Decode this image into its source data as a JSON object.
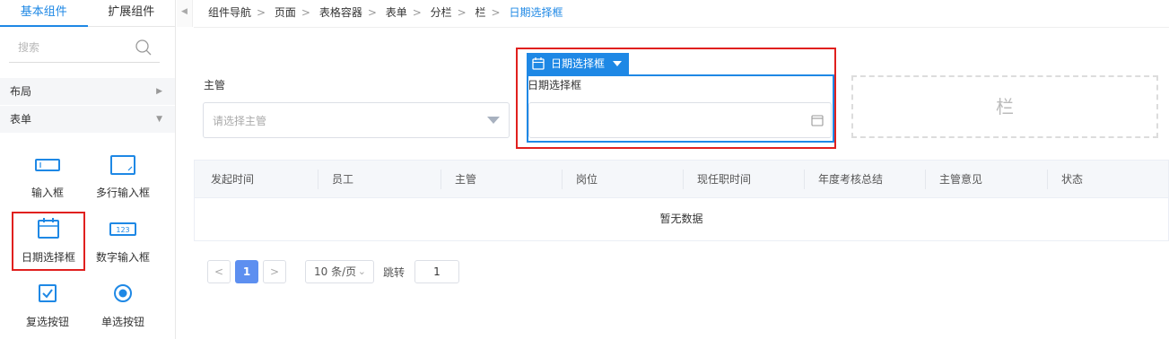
{
  "sidebar": {
    "tabs": [
      {
        "label": "基本组件",
        "active": true
      },
      {
        "label": "扩展组件",
        "active": false
      }
    ],
    "search_placeholder": "搜索",
    "groups": [
      {
        "label": "布局",
        "state": "collapsed"
      },
      {
        "label": "表单",
        "state": "expanded"
      }
    ],
    "components": [
      {
        "label": "输入框",
        "icon": "input-icon"
      },
      {
        "label": "多行输入框",
        "icon": "textarea-icon"
      },
      {
        "label": "日期选择框",
        "icon": "calendar-icon",
        "selected": true
      },
      {
        "label": "数字输入框",
        "icon": "number-input-icon"
      },
      {
        "label": "复选按钮",
        "icon": "checkbox-icon"
      },
      {
        "label": "单选按钮",
        "icon": "radio-icon"
      }
    ]
  },
  "breadcrumb": {
    "items": [
      "组件导航",
      "页面",
      "表格容器",
      "表单",
      "分栏",
      "栏"
    ],
    "current": "日期选择框"
  },
  "form": {
    "supervisor_label": "主管",
    "supervisor_placeholder": "请选择主管",
    "date_chip_label": "日期选择框",
    "date_field_label": "日期选择框",
    "column_placeholder": "栏"
  },
  "table": {
    "columns": [
      "发起时间",
      "员工",
      "主管",
      "岗位",
      "现任职时间",
      "年度考核总结",
      "主管意见",
      "状态"
    ],
    "rows": [],
    "empty_text": "暂无数据"
  },
  "pagination": {
    "prev": "<",
    "next": ">",
    "current_page": "1",
    "page_size": "10 条/页",
    "jump_label": "跳转",
    "jump_value": "1"
  },
  "colors": {
    "accent": "#1e88e5",
    "highlight": "#e0201e",
    "page_active": "#5d8ff0"
  }
}
